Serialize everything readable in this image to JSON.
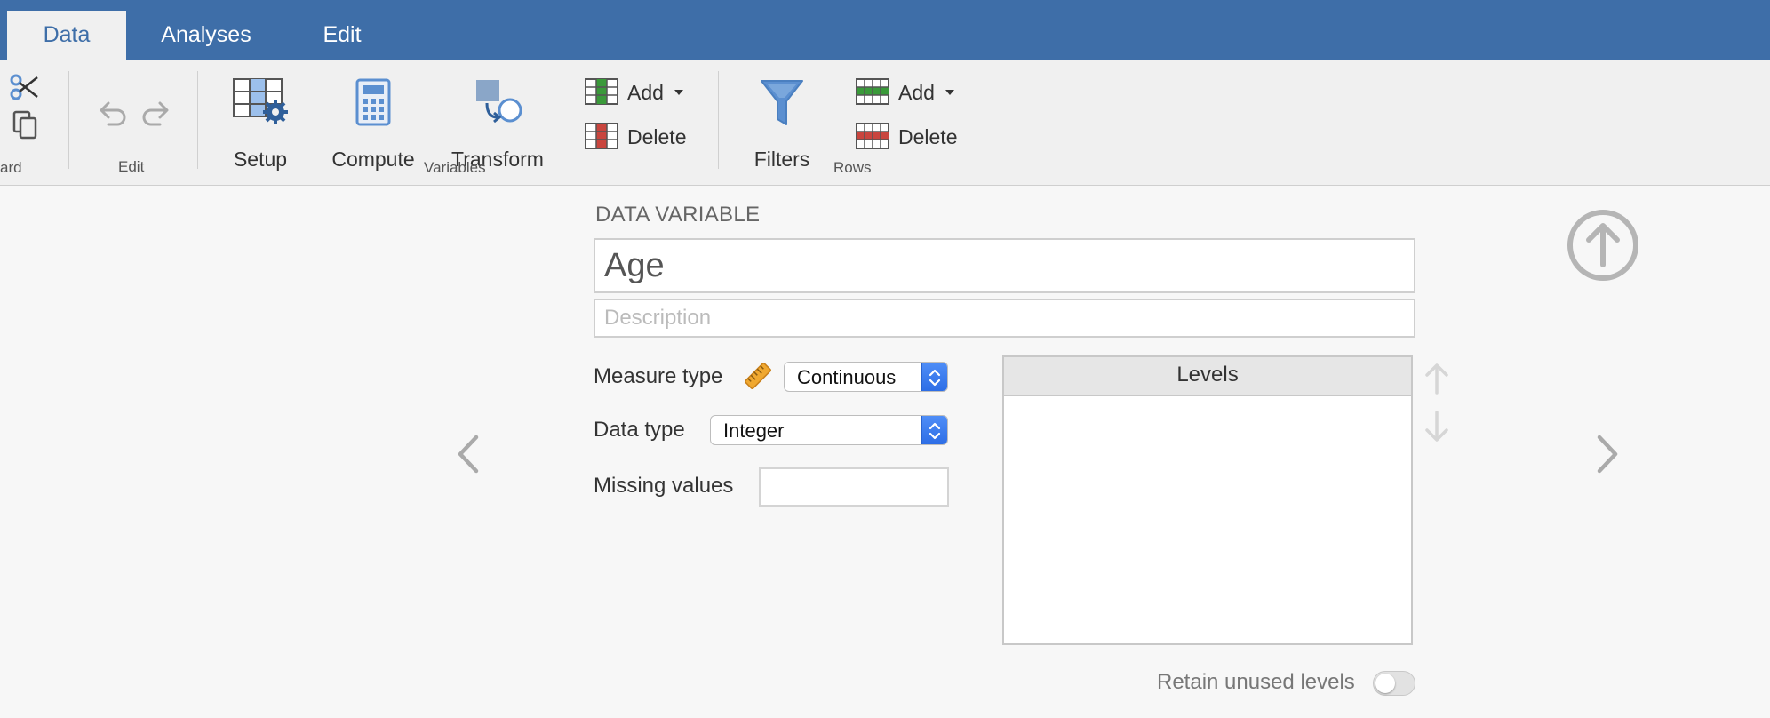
{
  "tabs": [
    {
      "label": "Data",
      "active": true
    },
    {
      "label": "Analyses",
      "active": false
    },
    {
      "label": "Edit",
      "active": false
    }
  ],
  "ribbon": {
    "clipboard": {
      "group_label": "ard"
    },
    "edit": {
      "group_label": "Edit"
    },
    "variables": {
      "group_label": "Variables",
      "setup": "Setup",
      "compute": "Compute",
      "transform": "Transform",
      "add": "Add",
      "delete": "Delete"
    },
    "rows": {
      "group_label": "Rows",
      "filters": "Filters",
      "add": "Add",
      "delete": "Delete"
    }
  },
  "variable": {
    "section_title": "DATA VARIABLE",
    "name": "Age",
    "description_placeholder": "Description",
    "measure_type_label": "Measure type",
    "measure_type_value": "Continuous",
    "data_type_label": "Data type",
    "data_type_value": "Integer",
    "missing_values_label": "Missing values",
    "missing_values_value": ""
  },
  "levels": {
    "header": "Levels",
    "items": [],
    "retain_label": "Retain unused levels",
    "retain_enabled": false
  },
  "colors": {
    "header_blue": "#3e6ea8",
    "select_blue": "#2d6ee6",
    "filter_blue": "#5b8fd0",
    "add_green": "#3a9a3a",
    "delete_red": "#c9453e",
    "ruler_orange": "#f0a830"
  }
}
